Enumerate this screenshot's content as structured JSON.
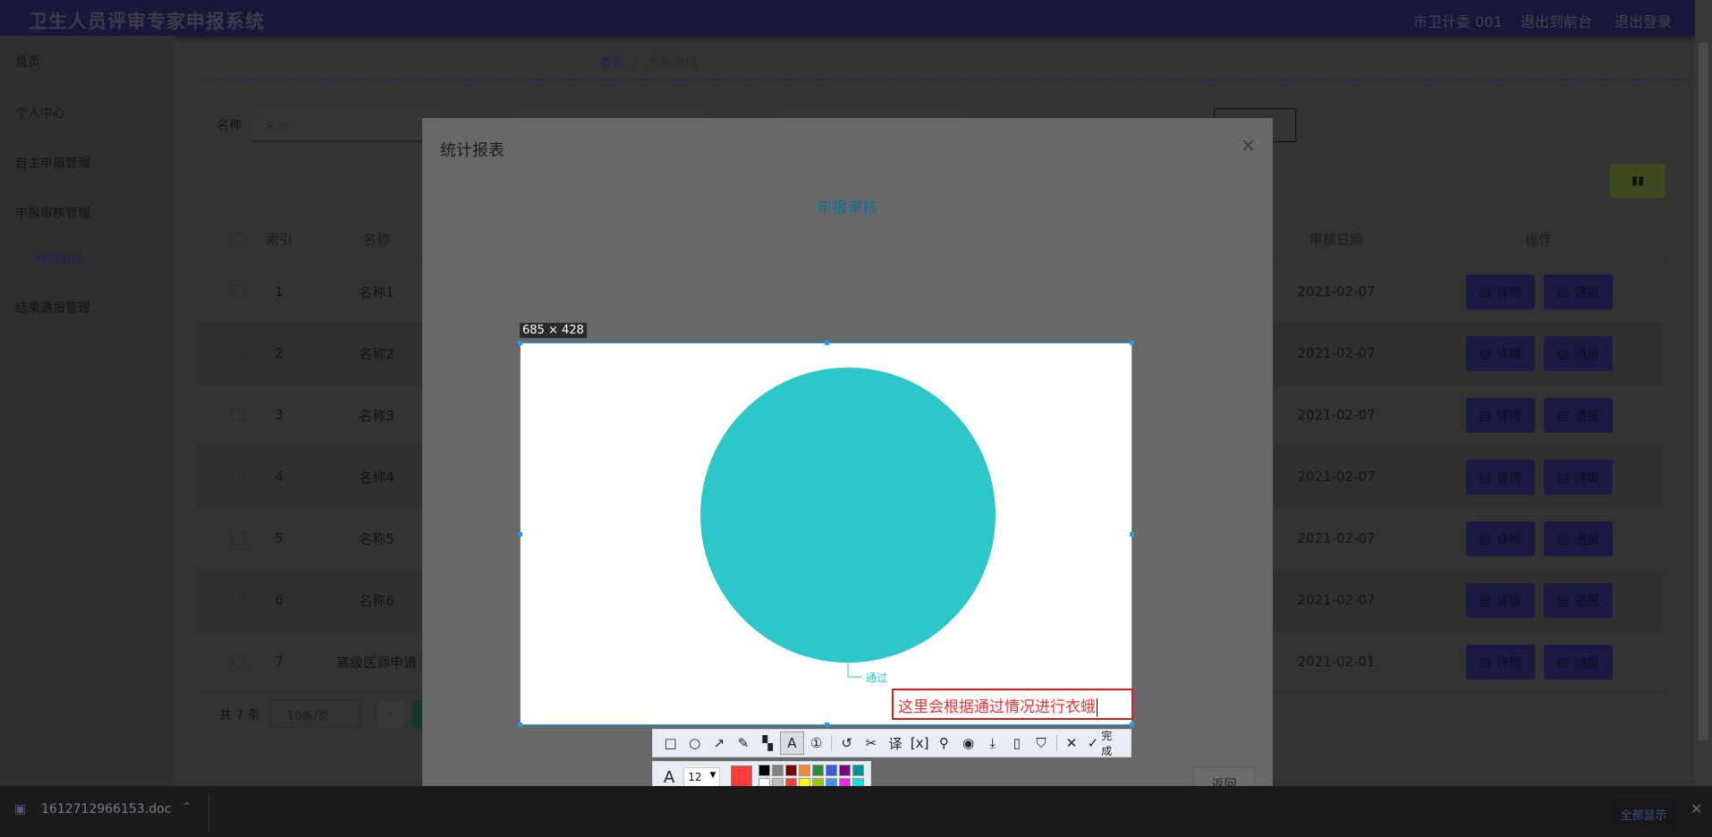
{
  "header": {
    "title": "卫生人员评审专家申报系统",
    "links": [
      "市卫计委 001",
      "退出到前台",
      "退出登录"
    ]
  },
  "sidebar": {
    "items": [
      {
        "label": "首页"
      },
      {
        "label": "个人中心"
      },
      {
        "label": "自主申报管理"
      },
      {
        "label": "申报审核管理"
      },
      {
        "label": "申报审核",
        "sub": true
      },
      {
        "label": "结果通报管理"
      }
    ]
  },
  "breadcrumb": {
    "home": "首页",
    "sep": "/",
    "current": "申报审核"
  },
  "search": {
    "label": "名称",
    "placeholder": "名称"
  },
  "table": {
    "headers": {
      "index": "索引",
      "name": "名称",
      "date": "审核日期",
      "ops": "操作"
    },
    "rows": [
      {
        "index": "1",
        "name": "名称1",
        "date": "2021-02-07"
      },
      {
        "index": "2",
        "name": "名称2",
        "date": "2021-02-07"
      },
      {
        "index": "3",
        "name": "名称3",
        "date": "2021-02-07"
      },
      {
        "index": "4",
        "name": "名称4",
        "date": "2021-02-07"
      },
      {
        "index": "5",
        "name": "名称5",
        "date": "2021-02-07"
      },
      {
        "index": "6",
        "name": "名称6",
        "date": "2021-02-07"
      },
      {
        "index": "7",
        "name": "高级医师申请",
        "date": "2021-02-01"
      }
    ],
    "detail_label": "详情",
    "notify_label": "通报"
  },
  "pagination": {
    "total": "共 7 条",
    "page_size": "10条/页"
  },
  "modal": {
    "title": "统计报表",
    "close": "×",
    "return_label": "返回"
  },
  "chart_data": {
    "type": "pie",
    "title": "申报审核",
    "categories": [
      "通过"
    ],
    "values": [
      100
    ],
    "colors": [
      "#2ec7c9"
    ]
  },
  "capture": {
    "size_label": "685 × 428",
    "annotation_text": "这里会根据通过情况进行衣蛾",
    "font_size": "12",
    "done_label": "完成",
    "palette": [
      "#000000",
      "#808080",
      "#800000",
      "#f08a3a",
      "#2e8b3a",
      "#3a5bd6",
      "#800080",
      "#0a9396",
      "#ffffff",
      "#c0c0c0",
      "#ff3b3b",
      "#ffff00",
      "#99cc00",
      "#3a97e6",
      "#ff22ee",
      "#22dddd"
    ],
    "current_color": "#ff3b3b"
  },
  "downloads": {
    "file": "1612712966153.doc",
    "show_all": "全部显示"
  }
}
